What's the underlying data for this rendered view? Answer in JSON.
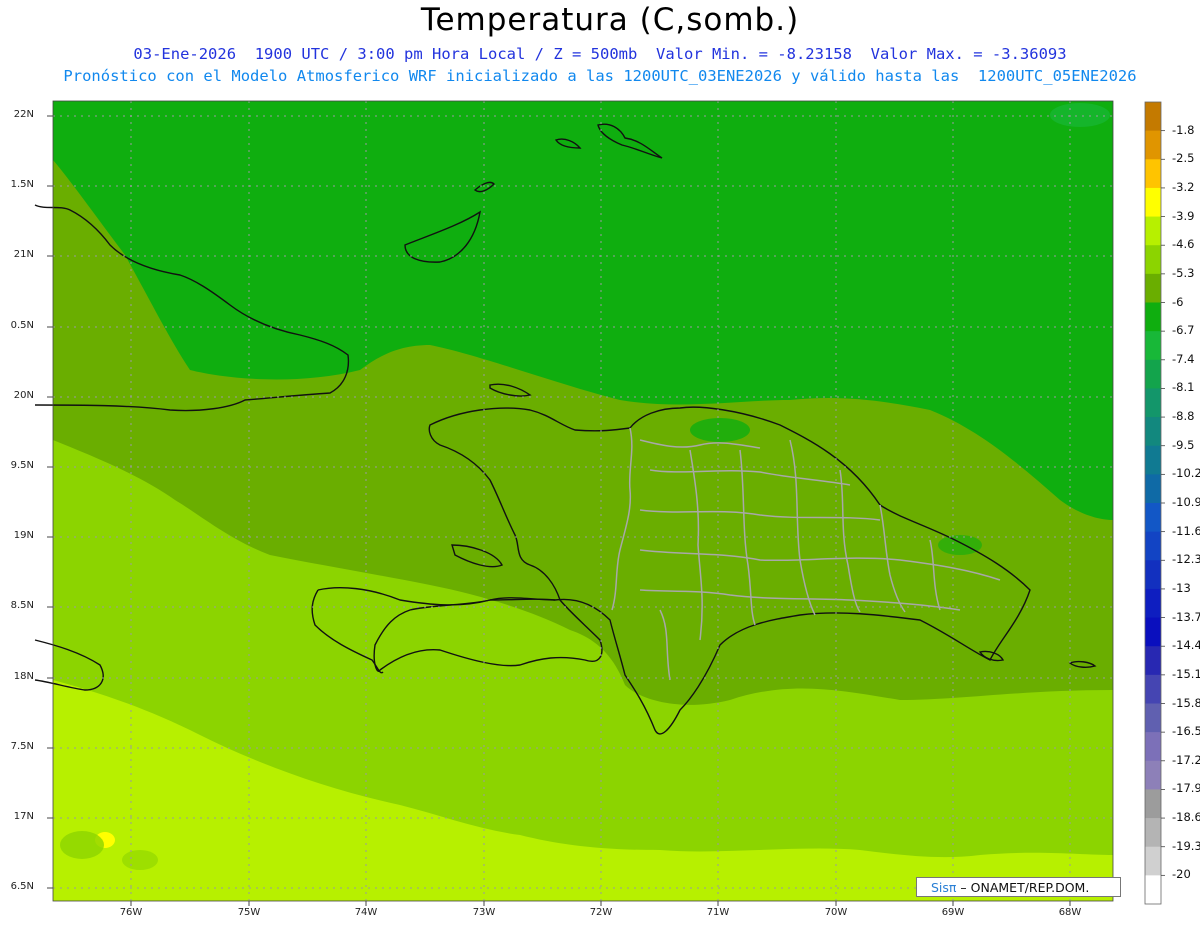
{
  "title": "Temperatura (C,somb.)",
  "subtitle_line1": "03-Ene-2026  1900 UTC / 3:00 pm Hora Local / Z = 500mb  Valor Min. = -8.23158  Valor Max. = -3.36093",
  "subtitle_line2": "Pronóstico con el Modelo Atmosferico WRF inicializado a las 1200UTC_03ENE2026 y válido hasta las  1200UTC_05ENE2026",
  "lat_labels": [
    "22N",
    "1.5N",
    "21N",
    "0.5N",
    "20N",
    "9.5N",
    "19N",
    "8.5N",
    "18N",
    "7.5N",
    "17N",
    "6.5N"
  ],
  "lon_labels": [
    "76W",
    "75W",
    "74W",
    "73W",
    "72W",
    "71W",
    "70W",
    "69W",
    "68W"
  ],
  "colorbar": {
    "labels": [
      "-1.8",
      "-2.5",
      "-3.2",
      "-3.9",
      "-4.6",
      "-5.3",
      "-6",
      "-6.7",
      "-7.4",
      "-8.1",
      "-8.8",
      "-9.5",
      "-10.2",
      "-10.9",
      "-11.6",
      "-12.3",
      "-13",
      "-13.7",
      "-14.4",
      "-15.1",
      "-15.8",
      "-16.5",
      "-17.2",
      "-17.9",
      "-18.6",
      "-19.3",
      "-20"
    ],
    "colors": [
      "#c47a00",
      "#e09500",
      "#ffc400",
      "#ffff00",
      "#b7f000",
      "#8cd400",
      "#6aae00",
      "#0fae0f",
      "#18b838",
      "#13a44c",
      "#13966a",
      "#12887e",
      "#107a92",
      "#0f6aa6",
      "#1257c6",
      "#1244c4",
      "#1230bf",
      "#0e1ec0",
      "#0a0fbe",
      "#2828b2",
      "#4545b2",
      "#6060b0",
      "#7c70b8",
      "#8d80b8",
      "#9c9c9c",
      "#b4b4b4",
      "#d0d0d0",
      "#ffffff"
    ]
  },
  "credit": {
    "sis": "Sisπ",
    "rest": " – ONAMET/REP.DOM."
  }
}
